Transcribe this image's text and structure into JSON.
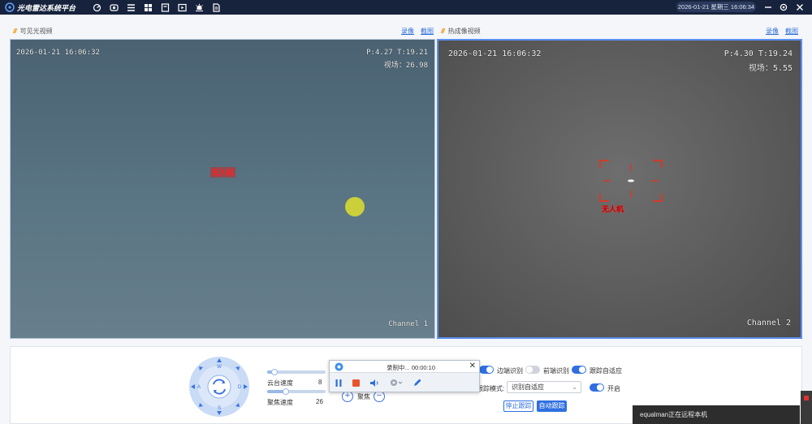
{
  "app": {
    "title": "光电雷达系统平台"
  },
  "header": {
    "datetime": "2026-01-21 星期三 16:06:34"
  },
  "toolbar": {
    "icons": [
      "radar-icon",
      "camera-icon",
      "list-icon",
      "grid-icon",
      "archive-icon",
      "media-icon",
      "alarm-icon",
      "document-icon"
    ]
  },
  "panels": {
    "visible": {
      "title": "可见光视频",
      "record_link": "录像",
      "snapshot_link": "截图",
      "osd_time": "2026-01-21 16:06:32",
      "osd_pt": "P:4.27 T:19.21",
      "osd_fov": "视场：26.98",
      "channel": "Channel 1",
      "target_label": "无人机"
    },
    "thermal": {
      "title": "热成像视频",
      "record_link": "录像",
      "snapshot_link": "截图",
      "osd_time": "2026-01-21 16:06:32",
      "osd_pt": "P:4.30 T:19.24",
      "osd_fov": "视场：5.55",
      "channel": "Channel 2",
      "target_label": "无人机"
    }
  },
  "ptz": {
    "labels": {
      "up": "W",
      "left": "A",
      "right": "D",
      "down": "S"
    }
  },
  "sliders": {
    "pan_speed": {
      "label": "云台速度",
      "value": "8",
      "level": 0.1
    },
    "focus_speed": {
      "label": "聚焦速度",
      "value": "26",
      "level": 0.3
    },
    "focus_label": "聚焦"
  },
  "recording": {
    "status": "录制中... 00:00:10",
    "close": "✕"
  },
  "detection": {
    "edge_recognition": {
      "label": "边端识别",
      "on": true
    },
    "front_recognition": {
      "label": "前端识别",
      "on": false
    },
    "track_adaptive": {
      "label": "跟踪自适应",
      "on": true
    },
    "track_mode_label": "跟踪模式:",
    "track_mode_value": "识别自适应",
    "enable": {
      "label": "开启",
      "on": true
    },
    "stop_button": "停止跟踪",
    "auto_button": "自动跟踪"
  },
  "remote": {
    "text": "equalman正在远程本机"
  },
  "colors": {
    "accent": "#2f6fe0",
    "topbar": "#17233d",
    "record_stop": "#e8542c"
  }
}
